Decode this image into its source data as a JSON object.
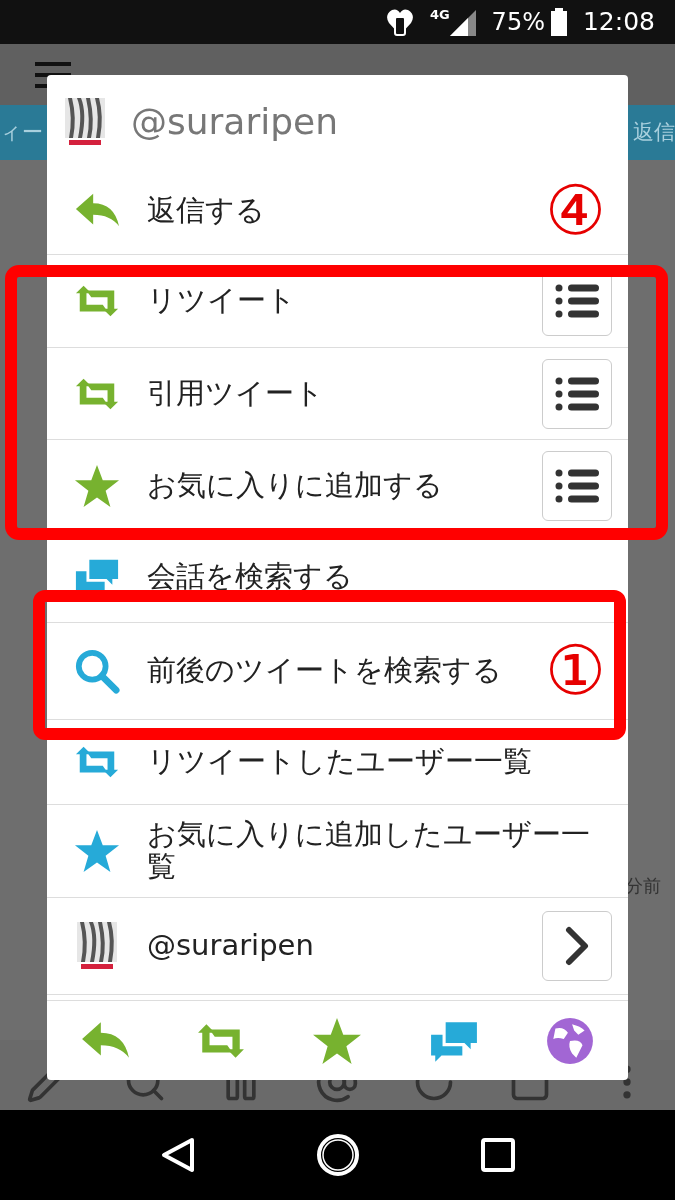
{
  "status_bar": {
    "network": "4G",
    "battery": "75%",
    "time": "12:08"
  },
  "tabs": [
    {
      "label": "ィー"
    },
    {
      "label": "返信"
    }
  ],
  "timeline": {
    "time": "分前"
  },
  "dialog": {
    "title": "@suraripen",
    "items": [
      {
        "kind": "reply",
        "label": "返信する",
        "color": "#77b22f",
        "annotation": "④"
      },
      {
        "kind": "retweet",
        "label": "リツイート",
        "color": "#77b22f",
        "options_button": true
      },
      {
        "kind": "retweet",
        "label": "引用ツイート",
        "color": "#77b22f",
        "options_button": true
      },
      {
        "kind": "star",
        "label": "お気に入りに追加する",
        "color": "#77b22f",
        "options_button": true
      },
      {
        "kind": "conversation",
        "label": "会話を検索する",
        "color": "#26aad8"
      },
      {
        "kind": "search",
        "label": "前後のツイートを検索する",
        "color": "#26aad8",
        "annotation": "①"
      },
      {
        "kind": "retweet",
        "label": "リツイートしたユーザー一覧",
        "color": "#26aad8"
      },
      {
        "kind": "star",
        "label": "お気に入りに追加したユーザー一覧",
        "color": "#26aad8"
      },
      {
        "kind": "user",
        "label": "@suraripen",
        "profile_button": true
      }
    ],
    "actions": [
      {
        "kind": "reply",
        "color": "#77b22f"
      },
      {
        "kind": "retweet",
        "color": "#77b22f"
      },
      {
        "kind": "star",
        "color": "#77b22f"
      },
      {
        "kind": "conversation",
        "color": "#26aad8"
      },
      {
        "kind": "globe",
        "color": "#a266d4"
      }
    ]
  }
}
